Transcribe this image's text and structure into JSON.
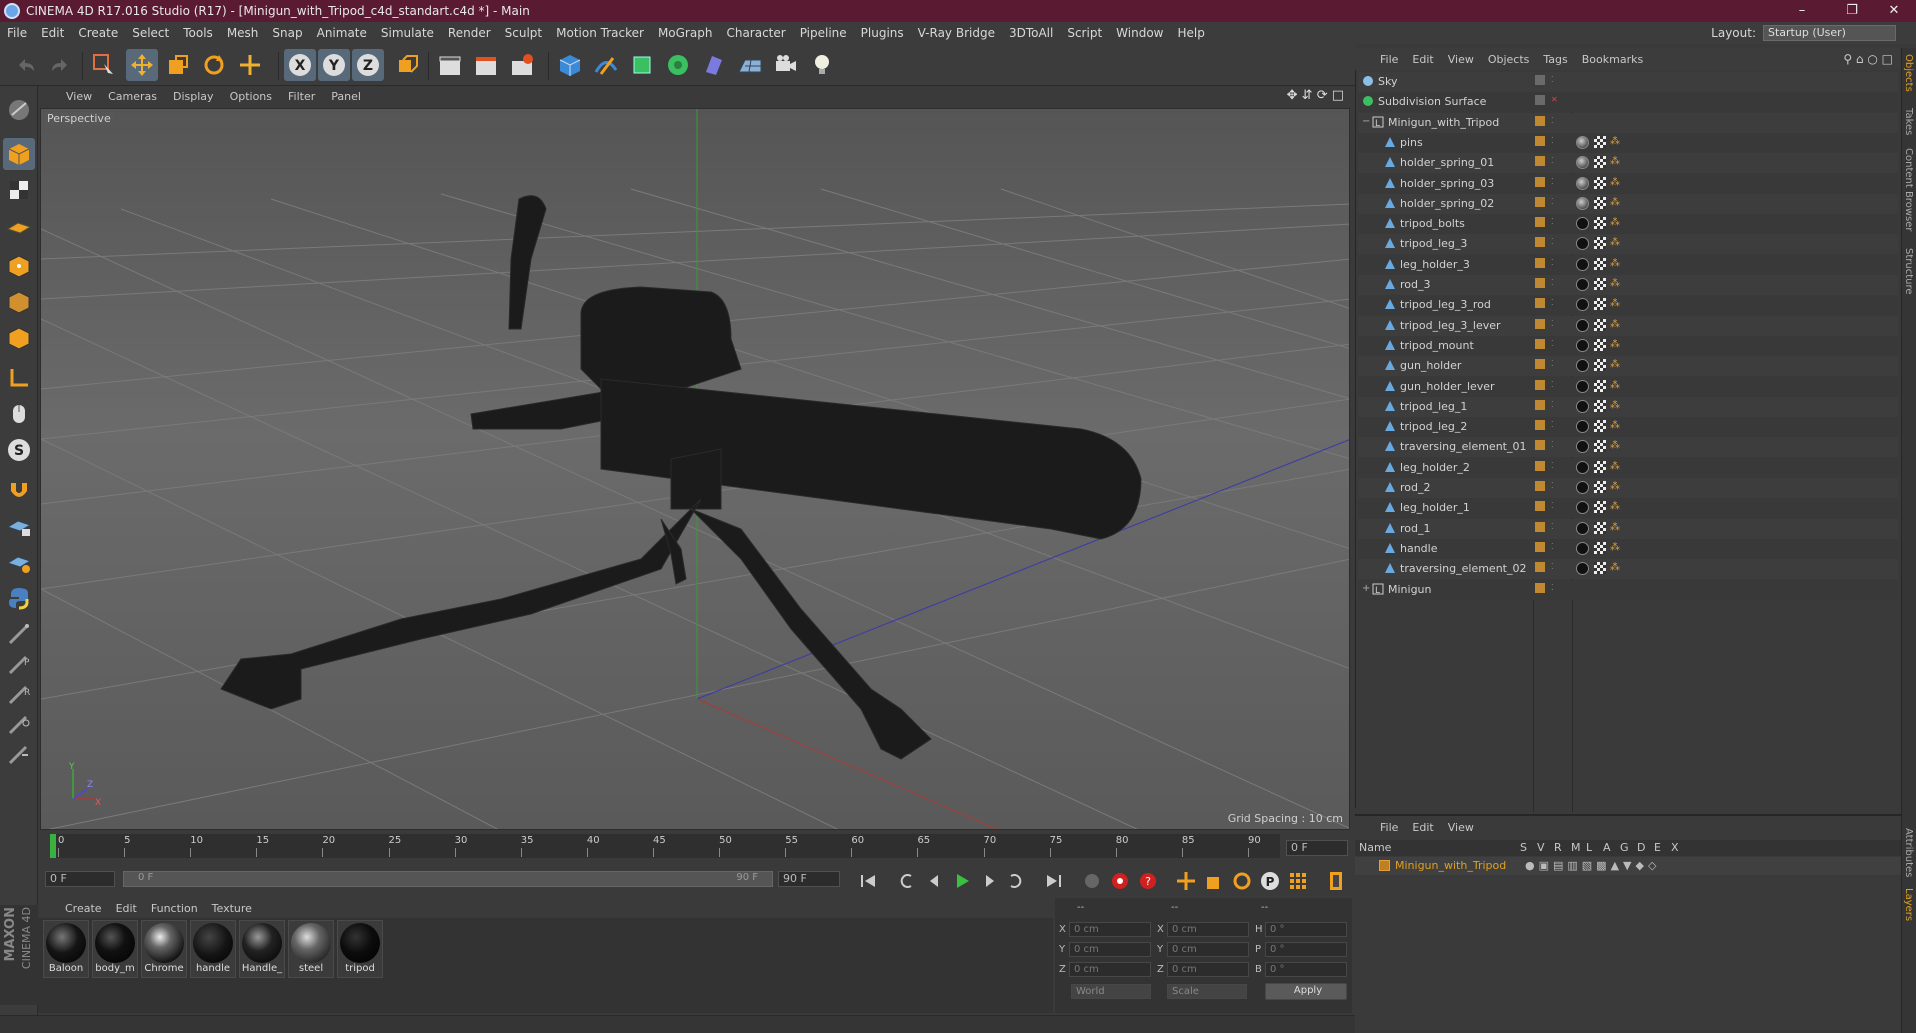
{
  "window": {
    "title": "CINEMA 4D R17.016 Studio (R17) - [Minigun_with_Tripod_c4d_standart.c4d *] - Main"
  },
  "menubar": {
    "items": [
      "File",
      "Edit",
      "Create",
      "Select",
      "Tools",
      "Mesh",
      "Snap",
      "Animate",
      "Simulate",
      "Render",
      "Sculpt",
      "Motion Tracker",
      "MoGraph",
      "Character",
      "Pipeline",
      "Plugins",
      "V-Ray Bridge",
      "3DToAll",
      "Script",
      "Window",
      "Help"
    ],
    "layout_label": "Layout:",
    "layout_value": "Startup (User)"
  },
  "viewport": {
    "menu": [
      "View",
      "Cameras",
      "Display",
      "Options",
      "Filter",
      "Panel"
    ],
    "label": "Perspective",
    "grid_spacing": "Grid Spacing : 10 cm",
    "axis_y": "Y",
    "axis_z": "Z",
    "axis_x": "X"
  },
  "timeline": {
    "ticks": [
      "0",
      "5",
      "10",
      "15",
      "20",
      "25",
      "30",
      "35",
      "40",
      "45",
      "50",
      "55",
      "60",
      "65",
      "70",
      "75",
      "80",
      "85",
      "90"
    ],
    "current_frame": "0 F",
    "start_field": "0 F",
    "range_start": "0 F",
    "range_end": "90 F",
    "end_field": "90 F"
  },
  "materials": {
    "menu": [
      "Create",
      "Edit",
      "Function",
      "Texture"
    ],
    "items": [
      "Baloon",
      "body_m",
      "Chrome",
      "handle",
      "Handle_",
      "steel",
      "tripod"
    ]
  },
  "coords": {
    "headers": [
      "--",
      "--",
      "--"
    ],
    "rows": [
      {
        "a": "X",
        "v1": "0 cm",
        "b": "X",
        "v2": "0 cm",
        "c": "H",
        "v3": "0 °"
      },
      {
        "a": "Y",
        "v1": "0 cm",
        "b": "Y",
        "v2": "0 cm",
        "c": "P",
        "v3": "0 °"
      },
      {
        "a": "Z",
        "v1": "0 cm",
        "b": "Z",
        "v2": "0 cm",
        "c": "B",
        "v3": "0 °"
      }
    ],
    "mode1": "World",
    "mode2": "Scale",
    "apply": "Apply"
  },
  "logo": {
    "line1": "MAXON",
    "line2": "CINEMA 4D"
  },
  "object_manager": {
    "menu": [
      "File",
      "Edit",
      "View",
      "Objects",
      "Tags",
      "Bookmarks"
    ],
    "objects": [
      {
        "name": "Sky",
        "level": 0
      },
      {
        "name": "Subdivision Surface",
        "level": 0
      },
      {
        "name": "Minigun_with_Tripod",
        "level": 1
      },
      {
        "name": "pins",
        "level": 2
      },
      {
        "name": "holder_spring_01",
        "level": 2
      },
      {
        "name": "holder_spring_03",
        "level": 2
      },
      {
        "name": "holder_spring_02",
        "level": 2
      },
      {
        "name": "tripod_bolts",
        "level": 2
      },
      {
        "name": "tripod_leg_3",
        "level": 2
      },
      {
        "name": "leg_holder_3",
        "level": 2
      },
      {
        "name": "rod_3",
        "level": 2
      },
      {
        "name": "tripod_leg_3_rod",
        "level": 2
      },
      {
        "name": "tripod_leg_3_lever",
        "level": 2
      },
      {
        "name": "tripod_mount",
        "level": 2
      },
      {
        "name": "gun_holder",
        "level": 2
      },
      {
        "name": "gun_holder_lever",
        "level": 2
      },
      {
        "name": "tripod_leg_1",
        "level": 2
      },
      {
        "name": "tripod_leg_2",
        "level": 2
      },
      {
        "name": "traversing_element_01",
        "level": 2
      },
      {
        "name": "leg_holder_2",
        "level": 2
      },
      {
        "name": "rod_2",
        "level": 2
      },
      {
        "name": "leg_holder_1",
        "level": 2
      },
      {
        "name": "rod_1",
        "level": 2
      },
      {
        "name": "handle",
        "level": 2
      },
      {
        "name": "traversing_element_02",
        "level": 2
      },
      {
        "name": "Minigun",
        "level": 1
      }
    ]
  },
  "right_tabs": [
    "Objects",
    "Takes",
    "Content Browser",
    "Structure",
    "Attributes",
    "Layers"
  ],
  "layer_manager": {
    "menu": [
      "File",
      "Edit",
      "View"
    ],
    "header_name": "Name",
    "columns": [
      "S",
      "V",
      "R",
      "M",
      "L",
      "A",
      "G",
      "D",
      "E",
      "X"
    ],
    "layer_name": "Minigun_with_Tripod"
  },
  "colors": {
    "titlebar": "#5a1a32",
    "layer_name": "#e0a020",
    "tag_orange": "#d8a040"
  }
}
